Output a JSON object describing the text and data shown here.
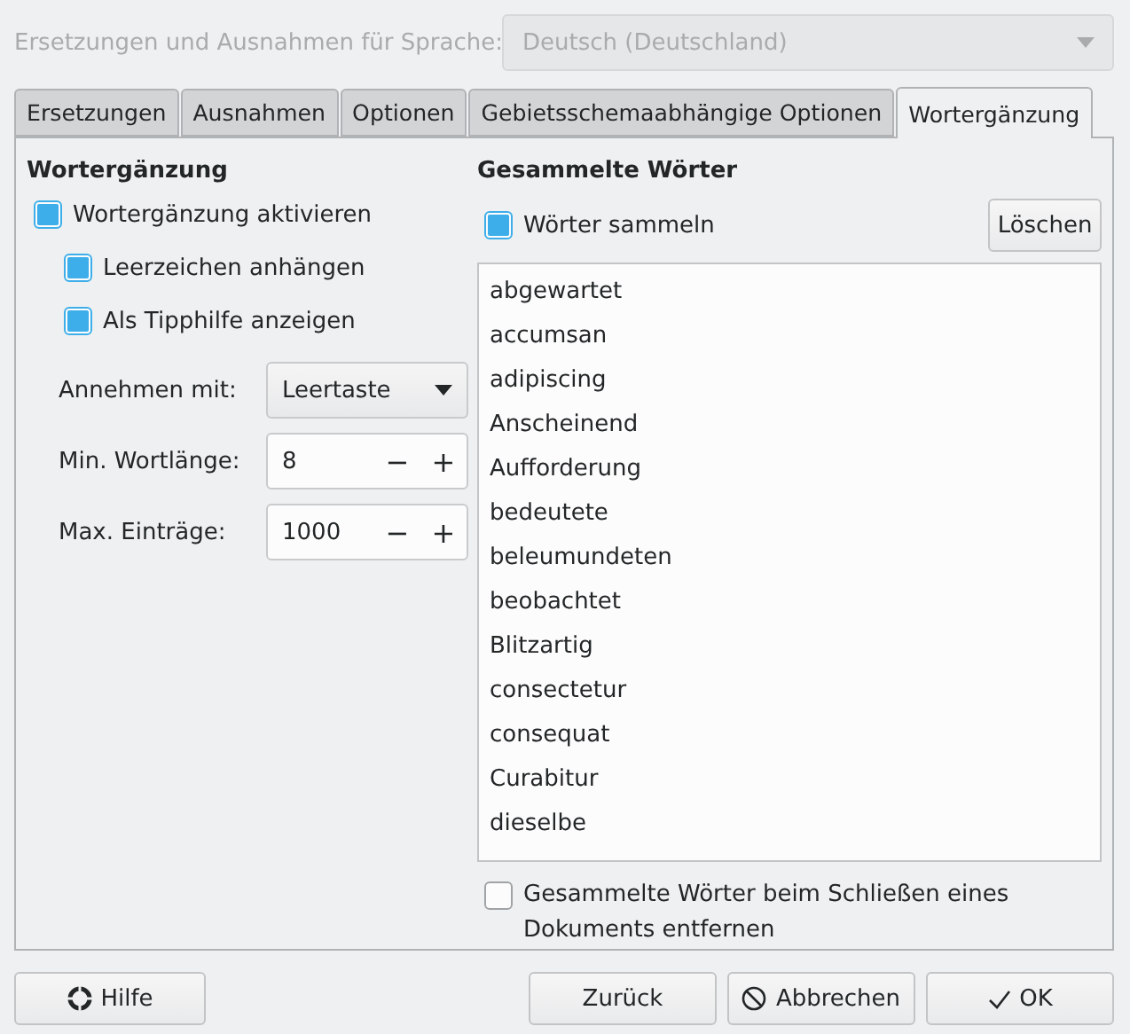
{
  "language": {
    "label": "Ersetzungen und Ausnahmen für Sprache:",
    "value": "Deutsch (Deutschland)",
    "disabled": true
  },
  "tabs": [
    {
      "label": "Ersetzungen",
      "selected": false
    },
    {
      "label": "Ausnahmen",
      "selected": false
    },
    {
      "label": "Optionen",
      "selected": false
    },
    {
      "label": "Gebietsschemaabhängige Optionen",
      "selected": false
    },
    {
      "label": "Wortergänzung",
      "selected": true
    }
  ],
  "completion": {
    "title": "Wortergänzung",
    "enable": {
      "label": "Wortergänzung aktivieren",
      "checked": true,
      "children": [
        {
          "label": "Leerzeichen anhängen",
          "checked": true
        },
        {
          "label": "Als Tipphilfe anzeigen",
          "checked": true
        }
      ]
    },
    "accept": {
      "label": "Annehmen mit:",
      "value": "Leertaste"
    },
    "spins": [
      {
        "label": "Min. Wortlänge:",
        "value": "8",
        "minus": "−",
        "plus": "+"
      },
      {
        "label": "Max. Einträge:",
        "value": "1000",
        "minus": "−",
        "plus": "+"
      }
    ]
  },
  "collected": {
    "title": "Gesammelte Wörter",
    "collect": {
      "label": "Wörter sammeln",
      "checked": true
    },
    "delete_button": "Löschen",
    "words": [
      "abgewartet",
      "accumsan",
      "adipiscing",
      "Anscheinend",
      "Aufforderung",
      "bedeutete",
      "beleumundeten",
      "beobachtet",
      "Blitzartig",
      "consectetur",
      "consequat",
      "Curabitur",
      "dieselbe"
    ],
    "remove_on_close": {
      "label": "Gesammelte Wörter beim Schließen eines Dokuments entfernen",
      "checked": false
    }
  },
  "buttons": [
    {
      "label": "Hilfe",
      "kind": "help"
    },
    {
      "label": "Zurück",
      "kind": "reset"
    },
    {
      "label": "Abbrechen",
      "kind": "cancel"
    },
    {
      "label": "OK",
      "kind": "ok"
    }
  ]
}
